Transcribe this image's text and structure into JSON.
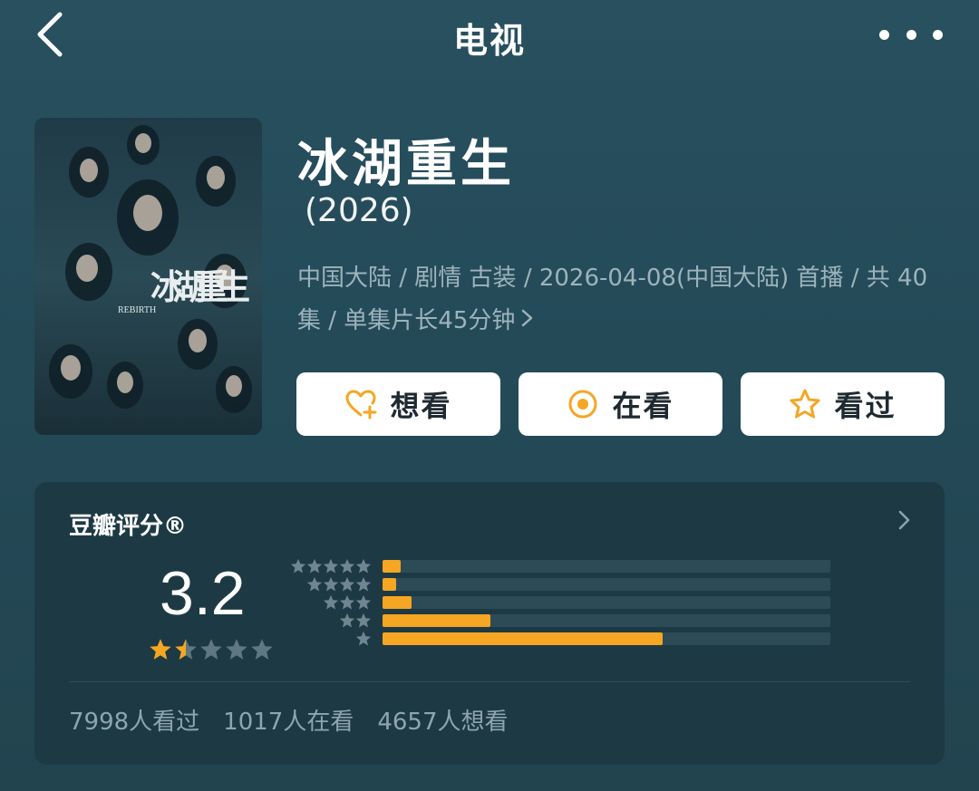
{
  "header": {
    "title": "电视"
  },
  "show": {
    "title": "冰湖重生",
    "year": "(2026)",
    "meta": "中国大陆 / 剧情 古装 / 2026-04-08(中国大陆) 首播 / 共 40 集 / 单集片长45分钟",
    "poster_title": "冰湖重生",
    "poster_en": "REBIRTH"
  },
  "actions": {
    "want": "想看",
    "watching": "在看",
    "watched": "看过"
  },
  "rating": {
    "title": "豆瓣评分®",
    "score": "3.2",
    "stars": 1.5,
    "distribution": [
      {
        "stars": 5,
        "fraction": 0.04
      },
      {
        "stars": 4,
        "fraction": 0.03
      },
      {
        "stars": 3,
        "fraction": 0.065
      },
      {
        "stars": 2,
        "fraction": 0.24
      },
      {
        "stars": 1,
        "fraction": 0.625
      }
    ],
    "counts": {
      "watched": "7998人看过",
      "watching": "1017人在看",
      "want": "4657人想看"
    }
  },
  "colors": {
    "accent": "#f5a623",
    "background": "#264c5a",
    "card": "#1d3a44"
  }
}
